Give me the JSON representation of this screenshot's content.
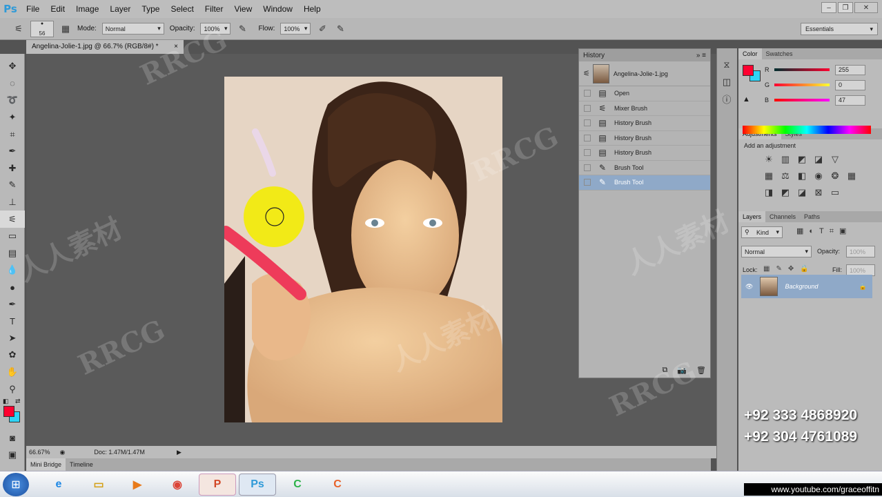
{
  "app": {
    "logo": "Ps"
  },
  "menu": [
    "File",
    "Edit",
    "Image",
    "Layer",
    "Type",
    "Select",
    "Filter",
    "View",
    "Window",
    "Help"
  ],
  "options": {
    "brush_size": "56",
    "mode_label": "Mode:",
    "mode_value": "Normal",
    "opacity_label": "Opacity:",
    "opacity_value": "100%",
    "flow_label": "Flow:",
    "flow_value": "100%",
    "workspace": "Essentials"
  },
  "document": {
    "tab_title": "Angelina-Jolie-1.jpg @ 66.7% (RGB/8#) *",
    "zoom": "66.67%",
    "doc_size": "Doc: 1.47M/1.47M"
  },
  "bottom_tabs": [
    "Mini Bridge",
    "Timeline"
  ],
  "history": {
    "title": "History",
    "snapshot": "Angelina-Jolie-1.jpg",
    "items": [
      "Open",
      "Mixer Brush",
      "History Brush",
      "History Brush",
      "History Brush",
      "Brush Tool",
      "Brush Tool"
    ]
  },
  "color_panel": {
    "tabs": [
      "Color",
      "Swatches"
    ],
    "channels": [
      {
        "label": "R",
        "value": "255"
      },
      {
        "label": "G",
        "value": "0"
      },
      {
        "label": "B",
        "value": "47"
      }
    ],
    "foreground": "#ff002f",
    "background": "#2fd3f5"
  },
  "adjustments": {
    "tabs": [
      "Adjustments",
      "Styles"
    ],
    "heading": "Add an adjustment"
  },
  "layers": {
    "tabs": [
      "Layers",
      "Channels",
      "Paths"
    ],
    "kind": "Kind",
    "blend": "Normal",
    "opacity_label": "Opacity:",
    "opacity_value": "100%",
    "lock_label": "Lock:",
    "fill_label": "Fill:",
    "fill_value": "100%",
    "layer_name": "Background"
  },
  "contact": {
    "phone1": "+92 333 4868920",
    "phone2": "+92 304 4761089",
    "youtube": "www.youtube.com/graceoffitn"
  },
  "watermark": [
    "RRCG",
    "人人素材"
  ]
}
